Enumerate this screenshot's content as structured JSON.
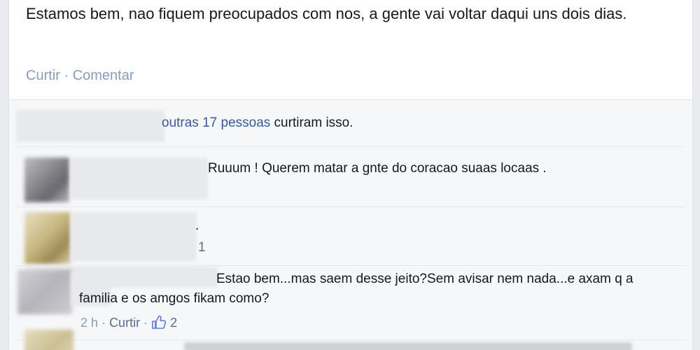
{
  "post": {
    "text": "Estamos bem, nao fiquem preocupados com nos, a gente vai voltar daqui uns dois dias.",
    "actions": {
      "like": "Curtir",
      "separator": "·",
      "comment": "Comentar"
    }
  },
  "likes": {
    "others_link": "outras 17 pessoas",
    "suffix": "curtiram isso."
  },
  "comments": [
    {
      "text": "Ruuum ! Querem matar a gnte do coracao suaas locaas ."
    },
    {
      "text": ".",
      "count": "1"
    },
    {
      "text": "Estao bem...mas saem desse jeito?Sem avisar nem nada...e axam q a familia e os amgos fikam como?",
      "time": "2 h",
      "separator": "·",
      "like": "Curtir",
      "separator2": "·",
      "like_count": "2"
    }
  ],
  "colors": {
    "link": "#3b5998",
    "meta": "#8a9bb9",
    "background": "#e9ebee",
    "comments_bg": "#f6f7f9"
  },
  "icons": {
    "like": "thumbs-up-icon"
  }
}
